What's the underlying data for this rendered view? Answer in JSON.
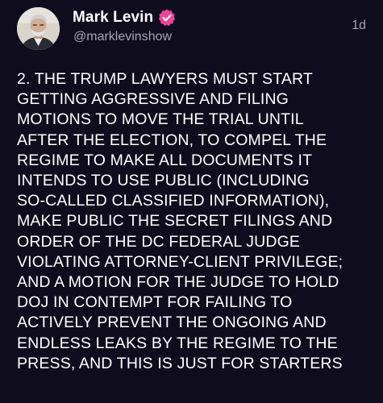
{
  "post": {
    "author": {
      "display_name": "Mark Levin",
      "handle": "@marklevinshow",
      "verified_icon": "verified-badge-icon",
      "avatar_icon": "profile-avatar"
    },
    "timestamp": "1d",
    "text_lines": [
      "2. THE TRUMP LAWYERS MUST START",
      "GETTING AGGRESSIVE AND FILING",
      "MOTIONS TO MOVE THE TRIAL UNTIL",
      "AFTER THE ELECTION, TO COMPEL THE",
      "REGIME TO MAKE ALL DOCUMENTS IT",
      "INTENDS TO USE PUBLIC (INCLUDING",
      "SO-CALLED CLASSIFIED INFORMATION),",
      "MAKE PUBLIC THE SECRET FILINGS AND",
      "ORDER OF THE DC FEDERAL JUDGE",
      "VIOLATING ATTORNEY-CLIENT PRIVILEGE;",
      "AND A MOTION FOR THE JUDGE TO HOLD",
      "DOJ IN CONTEMPT FOR FAILING TO",
      "ACTIVELY PREVENT THE ONGOING AND",
      "ENDLESS LEAKS BY THE REGIME TO THE",
      "PRESS, AND THIS IS JUST FOR STARTERS"
    ]
  },
  "colors": {
    "background": "#0f0c1d",
    "text": "#ffffff",
    "muted": "#a7a4b3",
    "verified_badge": "#e8479b"
  }
}
